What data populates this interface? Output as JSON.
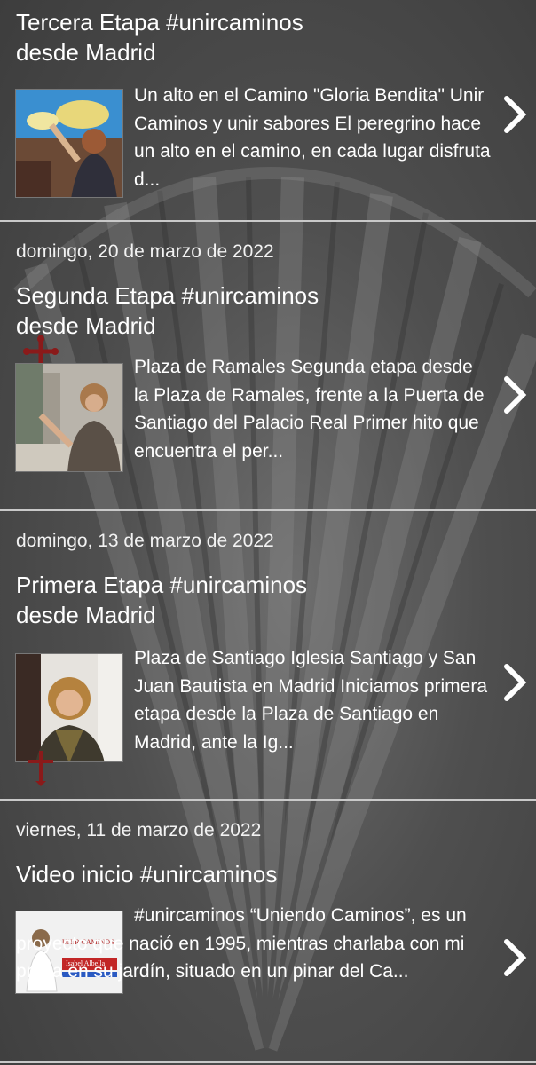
{
  "posts": [
    {
      "date": "",
      "title_line1": "Tercera Etapa #unircaminos",
      "title_line2": "desde Madrid",
      "snippet": "Un alto en el Camino \"Gloria Bendita\" Unir Caminos y unir sabores El peregrino hace un alto en el camino, en cada lugar disfruta d...",
      "thumb_icon": "woman-at-map-photo"
    },
    {
      "date": "domingo, 20 de marzo de 2022",
      "title_line1": "Segunda Etapa #unircaminos",
      "title_line2": "desde Madrid",
      "snippet": "  Plaza de Ramales Segunda etapa desde la Plaza de Ramales, frente a la Puerta de Santiago del Palacio Real Primer hito que encuentra el per...",
      "thumb_icon": "woman-in-plaza-photo"
    },
    {
      "date": "domingo, 13 de marzo de 2022",
      "title_line1": "Primera Etapa #unircaminos",
      "title_line2": "desde Madrid",
      "snippet": "  Plaza de Santiago Iglesia Santiago y San Juan Bautista en Madrid Iniciamos primera etapa desde la Plaza de Santiago en Madrid,  ante la Ig...",
      "thumb_icon": "woman-portrait-photo"
    },
    {
      "date": "viernes, 11 de marzo de 2022",
      "title_line1": "Video inicio #unircaminos",
      "title_line2": "",
      "snippet": "  #unircaminos “Uniendo Caminos”, es un proyecto que nació en 1995, mientras charlaba con mi prima en su jardín, situado en un pinar del Ca...",
      "thumb_icon": "video-cover-photo",
      "thumb_text1": "UNIR CAMINOS",
      "thumb_text2": "Isabel Albella"
    }
  ],
  "icons": {
    "arrow": "chevron-right-icon",
    "cross": "santiago-cross-icon"
  },
  "colors": {
    "background": "#4f4f4f",
    "separator": "#c9c9c9",
    "text": "#ffffff",
    "cross": "#8a1a1a"
  }
}
